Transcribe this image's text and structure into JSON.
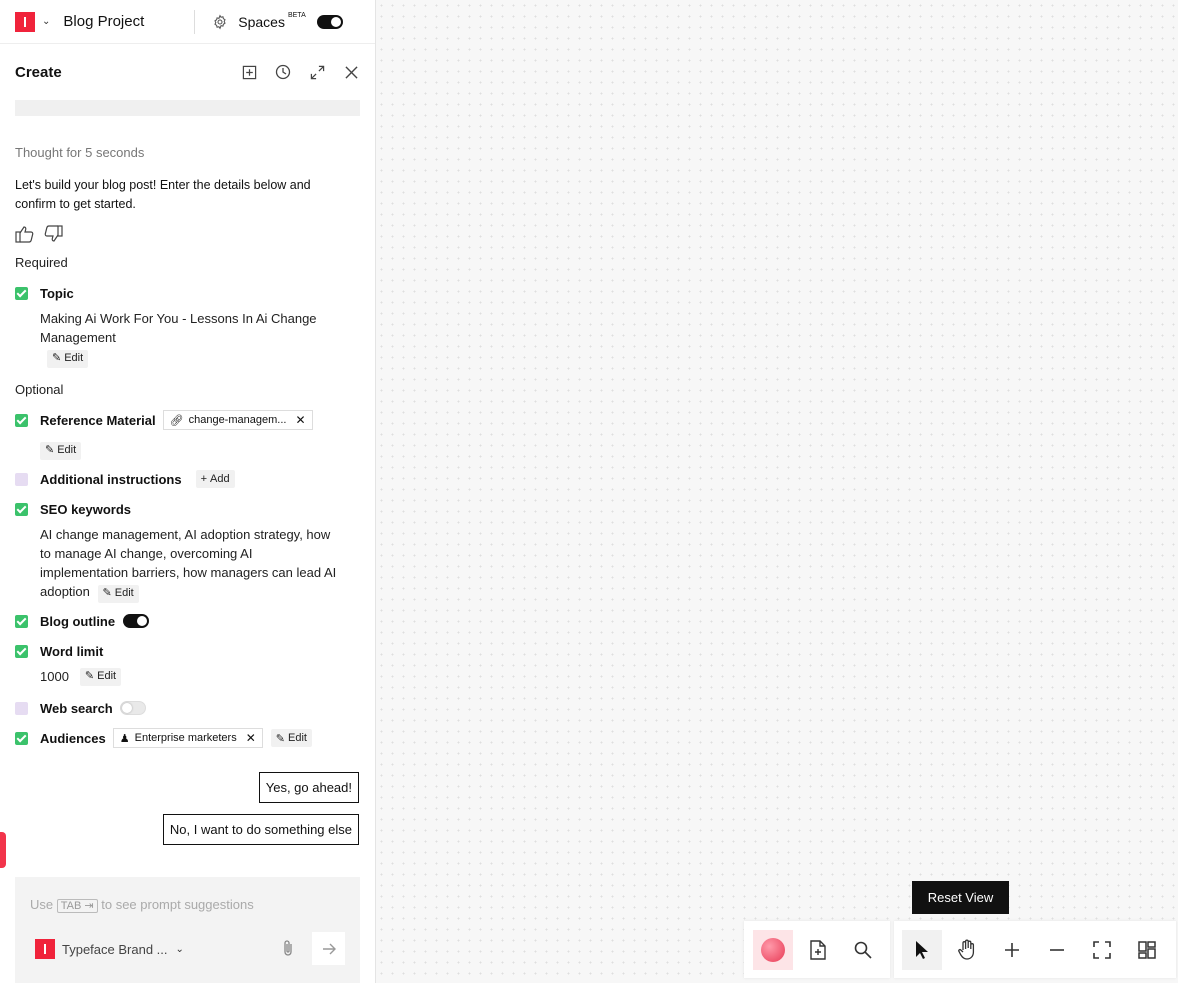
{
  "topbar": {
    "project_name": "Blog Project",
    "spaces_label": "Spaces",
    "beta_label": "BETA"
  },
  "panel": {
    "title": "Create",
    "thought": "Thought for 5 seconds",
    "intro": "Let's build your blog post! Enter the details below and confirm to get started.",
    "required_label": "Required",
    "optional_label": "Optional",
    "topic": {
      "label": "Topic",
      "value": "Making Ai Work For You - Lessons In Ai Change Management",
      "edit": "Edit"
    },
    "reference": {
      "label": "Reference Material",
      "chip": "change-managem...",
      "edit": "Edit"
    },
    "additional": {
      "label": "Additional instructions",
      "add": "Add"
    },
    "seo": {
      "label": "SEO keywords",
      "value": "AI change management, AI adoption strategy, how to manage AI change, overcoming AI implementation barriers, how managers can lead AI adoption",
      "edit": "Edit"
    },
    "outline": {
      "label": "Blog outline",
      "on": true
    },
    "word_limit": {
      "label": "Word limit",
      "value": "1000",
      "edit": "Edit"
    },
    "web_search": {
      "label": "Web search",
      "on": false
    },
    "audiences": {
      "label": "Audiences",
      "chip": "Enterprise marketers",
      "edit": "Edit"
    },
    "yes_button": "Yes, go ahead!",
    "no_button": "No, I want to do something else"
  },
  "composer": {
    "hint_before": "Use",
    "tab_key": "TAB ⇥",
    "hint_after": "to see prompt suggestions",
    "brand": "Typeface Brand ..."
  },
  "canvas": {
    "tooltip": "Reset View"
  },
  "colors": {
    "brand_red": "#f0233b",
    "check_green": "#3bc26b",
    "unchecked_lilac": "#e6dcf2"
  }
}
